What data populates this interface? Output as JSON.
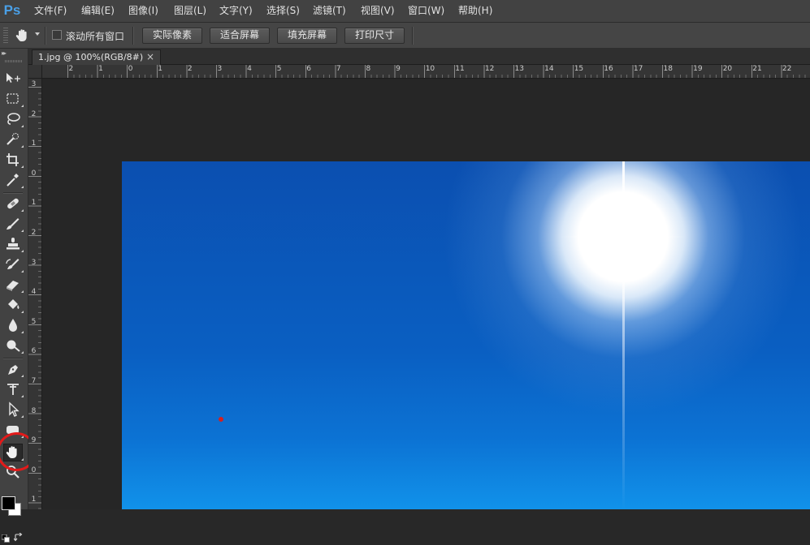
{
  "app": {
    "logo_text": "Ps"
  },
  "menu": [
    {
      "label": "文件(F)"
    },
    {
      "label": "编辑(E)"
    },
    {
      "label": "图像(I)"
    },
    {
      "label": "图层(L)"
    },
    {
      "label": "文字(Y)"
    },
    {
      "label": "选择(S)"
    },
    {
      "label": "滤镜(T)"
    },
    {
      "label": "视图(V)"
    },
    {
      "label": "窗口(W)"
    },
    {
      "label": "帮助(H)"
    }
  ],
  "options_bar": {
    "tool_icon": "hand-icon",
    "scroll_all_windows": {
      "label": "滚动所有窗口",
      "checked": false
    },
    "buttons": [
      {
        "label": "实际像素"
      },
      {
        "label": "适合屏幕"
      },
      {
        "label": "填充屏幕"
      },
      {
        "label": "打印尺寸"
      }
    ]
  },
  "document": {
    "tab_title": "1.jpg @ 100%(RGB/8#)",
    "close_glyph": "×"
  },
  "rulers": {
    "horizontal": [
      "2",
      "1",
      "0",
      "1",
      "2",
      "3",
      "4",
      "5",
      "6",
      "7",
      "8",
      "9",
      "10",
      "11",
      "12",
      "13",
      "14",
      "15",
      "16",
      "17",
      "18",
      "19",
      "20",
      "21",
      "22"
    ],
    "vertical": [
      "3",
      "2",
      "1",
      "0",
      "1",
      "2",
      "3",
      "4",
      "5",
      "6",
      "7",
      "8",
      "9",
      "0",
      "1"
    ]
  },
  "tools": [
    {
      "name": "move-tool",
      "icon": "move-icon"
    },
    {
      "name": "marquee-tool",
      "icon": "rectangular-marquee-icon"
    },
    {
      "name": "lasso-tool",
      "icon": "lasso-icon"
    },
    {
      "name": "quick-selection-tool",
      "icon": "quick-selection-icon"
    },
    {
      "name": "crop-tool",
      "icon": "crop-icon"
    },
    {
      "name": "eyedropper-tool",
      "icon": "eyedropper-icon"
    },
    {
      "name": "healing-brush-tool",
      "icon": "bandage-icon"
    },
    {
      "name": "brush-tool",
      "icon": "brush-icon"
    },
    {
      "name": "clone-stamp-tool",
      "icon": "stamp-icon"
    },
    {
      "name": "history-brush-tool",
      "icon": "history-brush-icon"
    },
    {
      "name": "eraser-tool",
      "icon": "eraser-icon"
    },
    {
      "name": "paint-bucket-tool",
      "icon": "paint-bucket-icon"
    },
    {
      "name": "blur-tool",
      "icon": "drop-icon"
    },
    {
      "name": "dodge-tool",
      "icon": "dodge-icon"
    },
    {
      "name": "pen-tool",
      "icon": "pen-icon"
    },
    {
      "name": "type-tool",
      "icon": "vertical-type-icon"
    },
    {
      "name": "path-selection-tool",
      "icon": "arrow-pointer-icon"
    },
    {
      "name": "shape-tool",
      "icon": "rounded-rectangle-icon"
    },
    {
      "name": "hand-tool",
      "icon": "hand-icon",
      "active": true
    },
    {
      "name": "zoom-tool",
      "icon": "magnifier-icon"
    }
  ],
  "colors": {
    "foreground": "#000000",
    "background": "#ffffff",
    "highlight_ring": "#e21a1a",
    "image_sky_top": "#0b4fb0",
    "image_sky_bottom": "#1192ea"
  }
}
